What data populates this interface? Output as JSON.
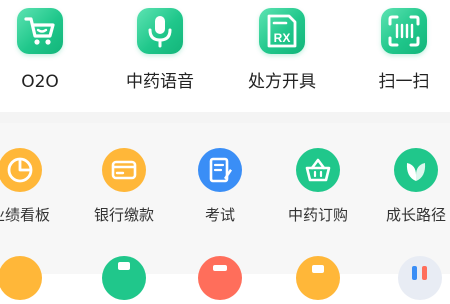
{
  "top_grid": {
    "items": [
      {
        "label": "O2O",
        "icon": "shopping-cart-icon"
      },
      {
        "label": "中药语音",
        "icon": "microphone-icon"
      },
      {
        "label": "处方开具",
        "icon": "prescription-rx-icon"
      },
      {
        "label": "扫一扫",
        "icon": "scan-barcode-icon"
      }
    ]
  },
  "service_grid": {
    "items": [
      {
        "label": "业绩看板",
        "icon": "pie-chart-icon",
        "color": "#ffb739"
      },
      {
        "label": "银行缴款",
        "icon": "bank-card-icon",
        "color": "#ffb739"
      },
      {
        "label": "考试",
        "icon": "exam-document-icon",
        "color": "#3a8ef6"
      },
      {
        "label": "中药订购",
        "icon": "herb-basket-icon",
        "color": "#20c78b"
      },
      {
        "label": "成长路径",
        "icon": "leaf-icon",
        "color": "#20c78b"
      }
    ]
  },
  "colors": {
    "green": "#20c78b",
    "orange": "#ffb739",
    "blue": "#3a8ef6",
    "red": "#ff6e5b"
  }
}
